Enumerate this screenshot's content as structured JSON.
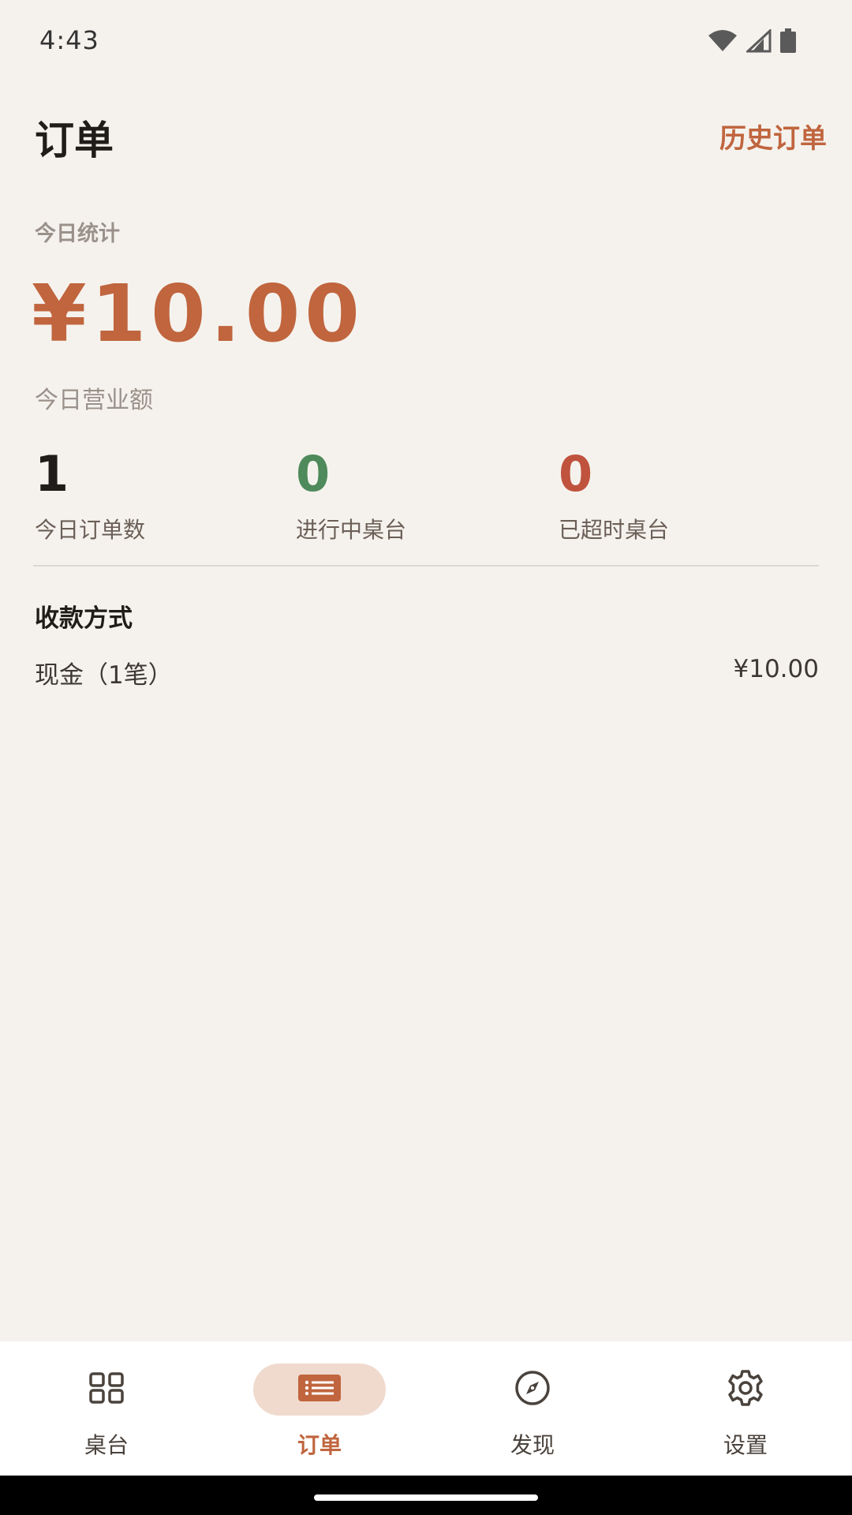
{
  "status_bar": {
    "time": "4:43",
    "icons": [
      "wifi-icon",
      "cellular-signal-icon",
      "battery-icon"
    ]
  },
  "header": {
    "title": "订单",
    "history_link": "历史订单"
  },
  "stats": {
    "section_label": "今日统计",
    "revenue": "¥10.00",
    "revenue_label": "今日营业额",
    "metrics": [
      {
        "value": "1",
        "label": "今日订单数",
        "color": "#1f1c19"
      },
      {
        "value": "0",
        "label": "进行中桌台",
        "color": "#4e8a5b"
      },
      {
        "value": "0",
        "label": "已超时桌台",
        "color": "#c0533e"
      }
    ]
  },
  "payment": {
    "title": "收款方式",
    "rows": [
      {
        "method": "现金（1笔）",
        "amount": "¥10.00"
      }
    ]
  },
  "bottom_nav": {
    "items": [
      {
        "label": "桌台",
        "icon": "grid-icon",
        "active": false
      },
      {
        "label": "订单",
        "icon": "receipt-icon",
        "active": true
      },
      {
        "label": "发现",
        "icon": "compass-icon",
        "active": false
      },
      {
        "label": "设置",
        "icon": "gear-icon",
        "active": false
      }
    ]
  },
  "colors": {
    "accent": "#c0653e",
    "background": "#f5f2ed",
    "nav_active_bg": "#f0dace"
  }
}
